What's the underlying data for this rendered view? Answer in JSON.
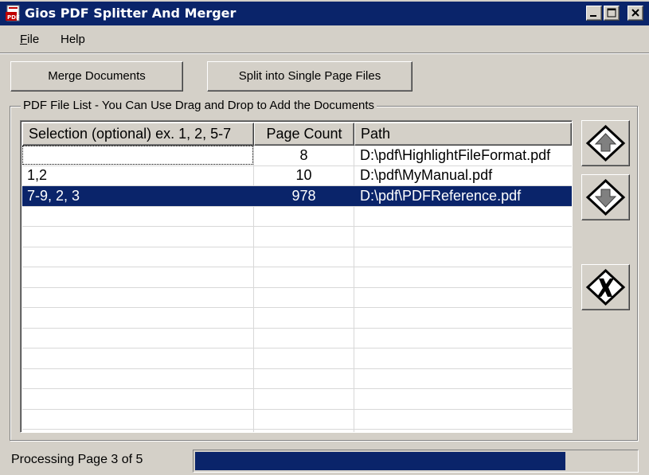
{
  "window": {
    "title": "Gios PDF Splitter And Merger",
    "icon": "pdf-app-icon",
    "controls": [
      "minimize-icon",
      "maximize-icon",
      "close-icon"
    ]
  },
  "menu": {
    "file": {
      "label": "File",
      "accel": "F",
      "rest": "ile"
    },
    "help": {
      "label": "Help"
    }
  },
  "toolbar": {
    "merge_label": "Merge Documents",
    "split_label": "Split into Single Page Files"
  },
  "file_list": {
    "group_label": "PDF File List - You Can Use Drag and Drop to Add the Documents",
    "columns": [
      "Selection (optional) ex. 1, 2, 5-7",
      "Page Count",
      "Path"
    ],
    "rows": [
      {
        "selection": "",
        "page_count": "8",
        "path": "D:\\pdf\\HighlightFileFormat.pdf",
        "selected": false
      },
      {
        "selection": "1,2",
        "page_count": "10",
        "path": "D:\\pdf\\MyManual.pdf",
        "selected": false
      },
      {
        "selection": "7-9, 2, 3",
        "page_count": "978",
        "path": "D:\\pdf\\PDFReference.pdf",
        "selected": true
      }
    ]
  },
  "side_buttons": {
    "up": "arrow-up-icon",
    "down": "arrow-down-icon",
    "remove": "x-remove-icon"
  },
  "status": {
    "text": "Processing Page 3 of 5",
    "progress": 0.84
  },
  "colors": {
    "face": "#d4d0c8",
    "selection": "#0a246a",
    "titlebar": "#0a246a"
  }
}
